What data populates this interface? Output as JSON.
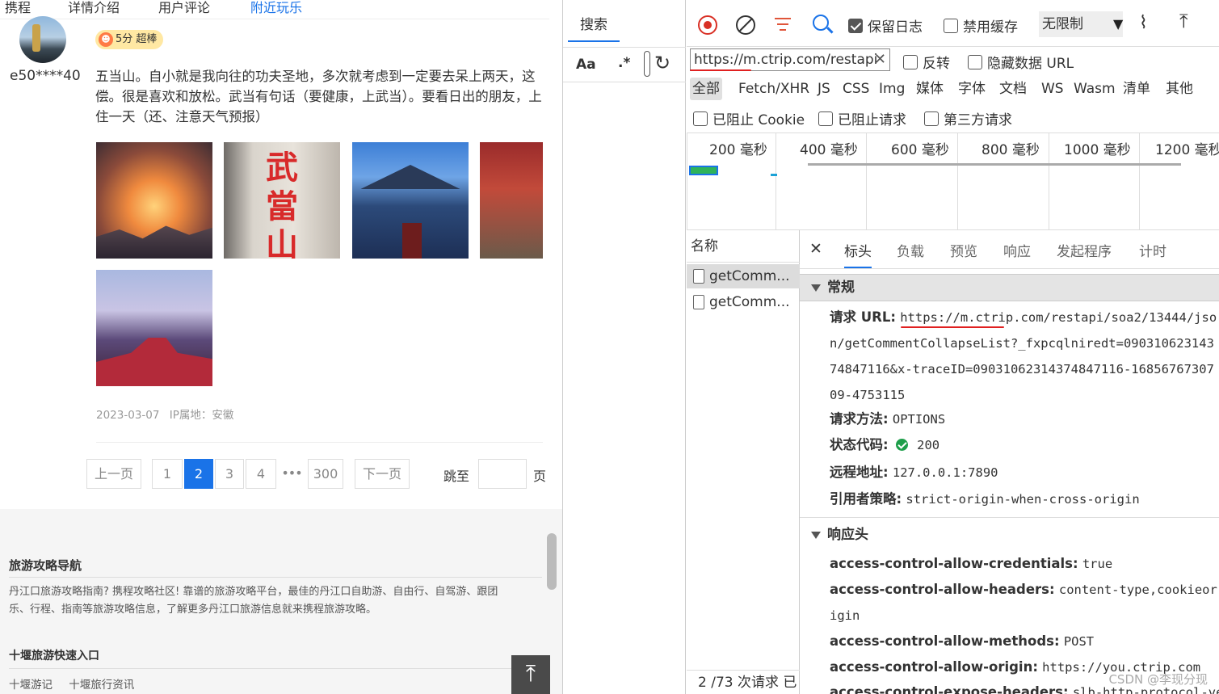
{
  "review": {
    "topnav": [
      "携程",
      "详情介绍",
      "用户评论",
      "附近玩乐"
    ],
    "username": "e50****40",
    "score_badge": "5分 超棒",
    "text": "五当山。自小就是我向往的功夫圣地，多次就考虑到一定要去呆上两天，这偿。很是喜欢和放松。武当有句话（要健康，上武当）。要看日出的朋友，上住一天（还、注意天气预报）",
    "photo2_chars": "武當山",
    "date": "2023-03-07",
    "ip": "IP属地：安徽"
  },
  "pagination": {
    "prev": "上一页",
    "pages": [
      "1",
      "2",
      "3",
      "4"
    ],
    "active_page": "2",
    "ellipsis": "•••",
    "last": "300",
    "next": "下一页",
    "jump_label": "跳至",
    "jump_suffix": "页"
  },
  "footer": {
    "nav_title": "旅游攻略导航",
    "nav_text_1": "丹江口旅游攻略指南? 携程攻略社区! 靠谱的旅游攻略平台，最佳的丹江口自助游、自由行、自驾游、跟团",
    "nav_text_2": "乐、行程、指南等旅游攻略信息，了解更多丹江口旅游信息就来携程旅游攻略。",
    "quick_title": "十堰旅游快速入口",
    "links": [
      "十堰游记",
      "十堰旅行资讯"
    ],
    "back_top": "⤒"
  },
  "devtools": {
    "search_tab": "搜索",
    "match_case": "Aa",
    "regex": ".*",
    "preserve_log": "保留日志",
    "preserve_log_checked": true,
    "disable_cache": "禁用缓存",
    "disable_cache_checked": false,
    "throttle": "无限制",
    "filter_value": "https://m.ctrip.com/restapi",
    "invert": "反转",
    "hide_data_urls": "隐藏数据 URL",
    "types": [
      "全部",
      "Fetch/XHR",
      "JS",
      "CSS",
      "Img",
      "媒体",
      "字体",
      "文档",
      "WS",
      "Wasm",
      "清单",
      "其他"
    ],
    "active_type": "全部",
    "blocked_cookies": "已阻止 Cookie",
    "blocked_requests": "已阻止请求",
    "third_party": "第三方请求",
    "timeline_ticks": [
      "200 毫秒",
      "400 毫秒",
      "600 毫秒",
      "800 毫秒",
      "1000 毫秒",
      "1200 毫秒"
    ],
    "name_header": "名称",
    "requests": [
      "getComm...",
      "getComm..."
    ],
    "status_text": "2 /73 次请求  已",
    "detail_tabs": [
      "标头",
      "负载",
      "预览",
      "响应",
      "发起程序",
      "计时"
    ],
    "active_detail_tab": "标头",
    "general_title": "常规",
    "general": {
      "request_url_key": "请求 URL:",
      "request_url": "https://m.ctrip.com/restapi/soa2/13444/json/getCommentCollapseList?_fxpcqlniredt=09031062314374847116&x-traceID=09031062314374847116-1685676730709-4753115",
      "method_key": "请求方法:",
      "method": "OPTIONS",
      "status_key": "状态代码:",
      "status": "200",
      "remote_key": "远程地址:",
      "remote": "127.0.0.1:7890",
      "referrer_key": "引用者策略:",
      "referrer": "strict-origin-when-cross-origin"
    },
    "response_headers_title": "响应头",
    "response_headers": [
      {
        "k": "access-control-allow-credentials:",
        "v": "true"
      },
      {
        "k": "access-control-allow-headers:",
        "v": "content-type,cookieorigin"
      },
      {
        "k": "access-control-allow-methods:",
        "v": "POST"
      },
      {
        "k": "access-control-allow-origin:",
        "v": "https://you.ctrip.com"
      },
      {
        "k": "access-control-expose-headers:",
        "v": "slb-http-protocol-version"
      }
    ],
    "watermark": "CSDN @李现分现"
  }
}
